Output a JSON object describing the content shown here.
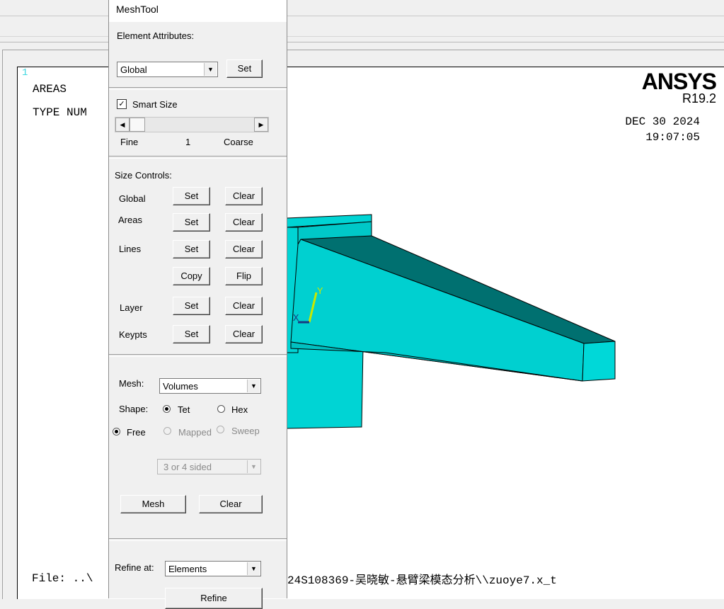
{
  "graphics": {
    "window_number": "1",
    "plot_label_1": "AREAS",
    "plot_label_2": "TYPE NUM",
    "brand": "ANSYS",
    "release": "R19.2",
    "date": "DEC 30 2024",
    "time": "19:07:05",
    "file_line": "File: ..\\",
    "file_tail": "24S108369-吴晓敏-悬臂梁模态分析\\\\zuoye7.x_t",
    "triad_x": "X",
    "triad_y": "Y",
    "colors": {
      "model_face": "#00d4d4",
      "model_dark": "#007070",
      "model_side": "#00b6b6"
    }
  },
  "meshtool": {
    "title": "MeshTool",
    "element_attributes_label": "Element Attributes:",
    "element_attributes_value": "Global",
    "set_label": "Set",
    "smart_size_label": "Smart Size",
    "smart_size_checked": true,
    "slider_fine": "Fine",
    "slider_value": "1",
    "slider_coarse": "Coarse",
    "size_controls_label": "Size Controls:",
    "rows": {
      "global": "Global",
      "areas": "Areas",
      "lines": "Lines",
      "layer": "Layer",
      "keypts": "Keypts"
    },
    "btn_set": "Set",
    "btn_clear": "Clear",
    "btn_copy": "Copy",
    "btn_flip": "Flip",
    "mesh_label": "Mesh:",
    "mesh_value": "Volumes",
    "shape_label": "Shape:",
    "shape_tet": "Tet",
    "shape_hex": "Hex",
    "mode_free": "Free",
    "mode_mapped": "Mapped",
    "mode_sweep": "Sweep",
    "sided_value": "3 or 4 sided",
    "btn_mesh": "Mesh",
    "btn_mesh_clear": "Clear",
    "refine_label": "Refine at:",
    "refine_value": "Elements",
    "btn_refine": "Refine"
  }
}
